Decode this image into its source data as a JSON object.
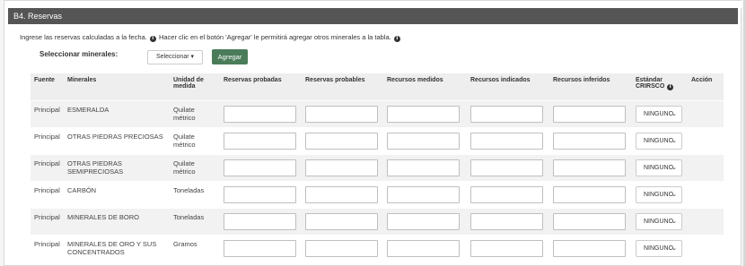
{
  "section": {
    "title": "B4. Reservas"
  },
  "instructions": {
    "part1": "Ingrese las reservas calculadas a la fecha.",
    "part2": "Hacer clic en el botón 'Agregar' le permitirá agregar otros minerales a la tabla.",
    "info_icon": "info-circle-icon"
  },
  "selector": {
    "label": "Seleccionar minerales:",
    "dropdown_label": "Seleccionar",
    "dropdown_icon": "caret-down-icon",
    "add_button": "Agregar",
    "add_button_color": "#4a7c59"
  },
  "table": {
    "headers": {
      "fuente": "Fuente",
      "minerales": "Minerales",
      "unidad": "Unidad de medida",
      "reservas_probadas": "Reservas probadas",
      "reservas_probables": "Reservas probables",
      "recursos_medidos": "Recursos medidos",
      "recursos_indicados": "Recursos indicados",
      "recursos_inferidos": "Recursos inferidos",
      "estandar": "Estándar CRIRSCO",
      "accion": "Acción"
    },
    "rows": [
      {
        "fuente": "Principal",
        "mineral": "ESMERALDA",
        "unidad": "Quilate métrico",
        "estandar": "NINGUNO"
      },
      {
        "fuente": "Principal",
        "mineral": "OTRAS PIEDRAS PRECIOSAS",
        "unidad": "Quilate métrico",
        "estandar": "NINGUNO"
      },
      {
        "fuente": "Principal",
        "mineral": "OTRAS PIEDRAS SEMIPRECIOSAS",
        "unidad": "Quilate métrico",
        "estandar": "NINGUNO"
      },
      {
        "fuente": "Principal",
        "mineral": "CARBÓN",
        "unidad": "Toneladas",
        "estandar": "NINGUNO"
      },
      {
        "fuente": "Principal",
        "mineral": "MINERALES DE BORO",
        "unidad": "Toneladas",
        "estandar": "NINGUNO"
      },
      {
        "fuente": "Principal",
        "mineral": "MINERALES DE ORO Y SUS CONCENTRADOS",
        "unidad": "Gramos",
        "estandar": "NINGUNO"
      }
    ]
  }
}
